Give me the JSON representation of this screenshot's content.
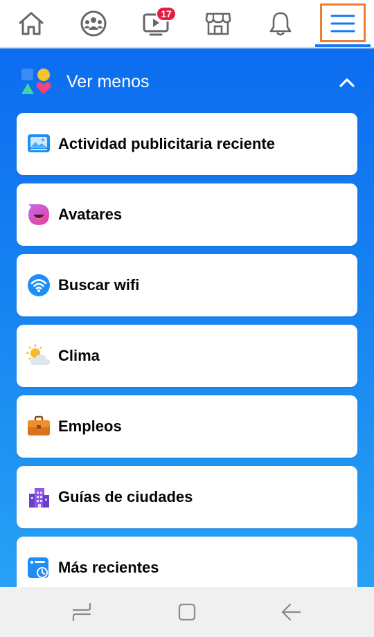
{
  "topnav": {
    "tabs": [
      {
        "icon": "home-icon"
      },
      {
        "icon": "groups-icon"
      },
      {
        "icon": "watch-icon",
        "badge": "17"
      },
      {
        "icon": "marketplace-icon"
      },
      {
        "icon": "bell-icon"
      },
      {
        "icon": "menu-icon"
      }
    ],
    "accent": "#1877f2",
    "highlight_color": "#ee7d32"
  },
  "section": {
    "title": "Ver menos",
    "icon": "shortcuts-shapes-icon",
    "toggle_icon": "chevron-up-icon"
  },
  "items": [
    {
      "label": "Actividad publicitaria reciente",
      "icon": "ad-activity-icon"
    },
    {
      "label": "Avatares",
      "icon": "avatar-icon"
    },
    {
      "label": "Buscar wifi",
      "icon": "wifi-icon"
    },
    {
      "label": "Clima",
      "icon": "weather-icon"
    },
    {
      "label": "Empleos",
      "icon": "briefcase-icon"
    },
    {
      "label": "Guías de ciudades",
      "icon": "city-guide-icon"
    },
    {
      "label": "Más recientes",
      "icon": "recent-feed-icon"
    }
  ],
  "system_nav": {
    "buttons": [
      "recents-icon",
      "home-square-icon",
      "back-arrow-icon"
    ]
  }
}
